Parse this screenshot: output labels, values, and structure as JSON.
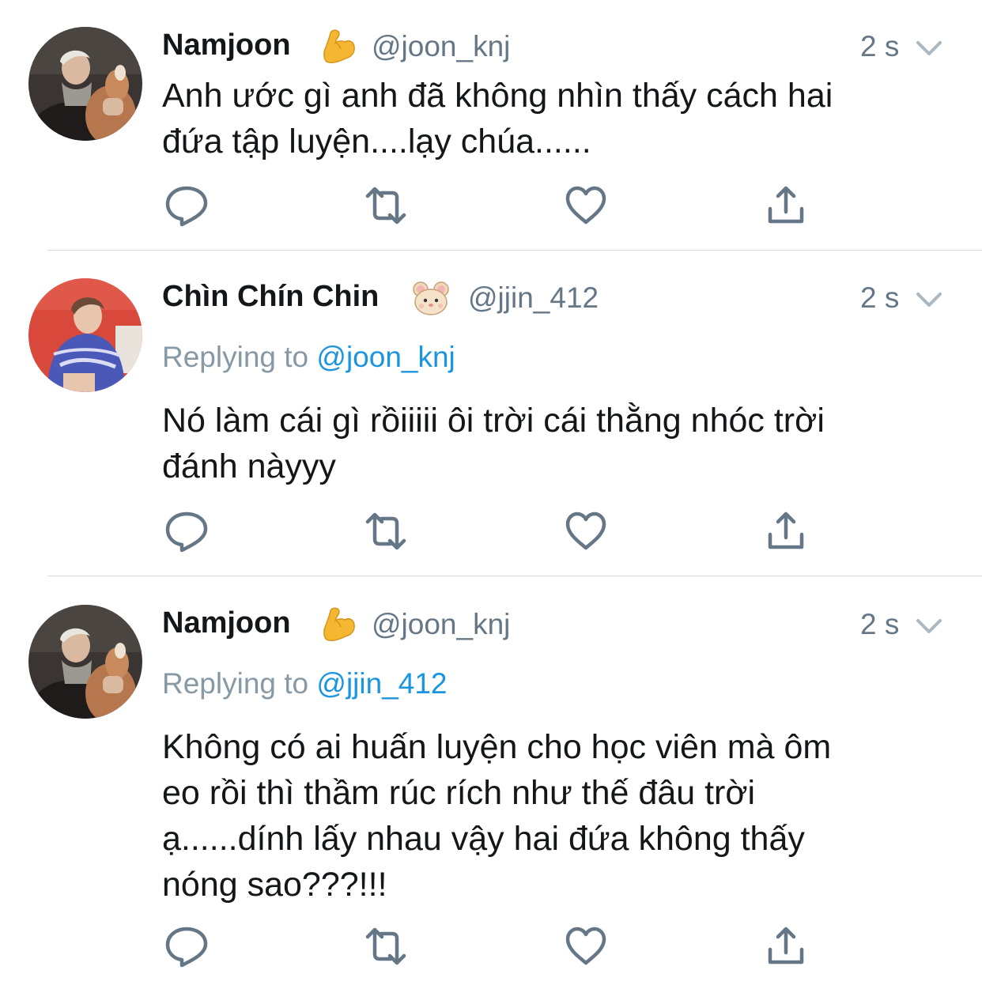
{
  "tweets": [
    {
      "name": "Namjoon",
      "emoji": "flexed-biceps",
      "handle": "@joon_knj",
      "time": "2 s",
      "replying_label": "",
      "replying_to": "",
      "lines": [
        "Anh ước gì anh đã không nhìn thấy cách hai",
        "đứa tập luyện....lạy chúa......"
      ]
    },
    {
      "name": "Chìn Chín Chin",
      "emoji": "hamster",
      "handle": "@jjin_412",
      "time": "2 s",
      "replying_label": "Replying to",
      "replying_to": "@joon_knj",
      "lines": [
        "Nó làm cái gì rồiiiii ôi trời cái thằng nhóc trời",
        "đánh nàyyy"
      ]
    },
    {
      "name": "Namjoon",
      "emoji": "flexed-biceps",
      "handle": "@joon_knj",
      "time": "2 s",
      "replying_label": "Replying to",
      "replying_to": "@jjin_412",
      "lines": [
        "Không có ai huấn luyện cho học viên mà ôm",
        "eo rồi thì thầm rúc rích như thế đâu trời",
        "ạ......dính lấy nhau vậy hai đứa không thấy",
        "nóng sao???!!!"
      ]
    }
  ],
  "icons": {
    "reply": "reply-icon",
    "retweet": "retweet-icon",
    "like": "heart-icon",
    "share": "share-icon",
    "more": "chevron-down-icon"
  },
  "colors": {
    "text": "#14171a",
    "secondary": "#657786",
    "mention": "#1b95e0",
    "icon": "#657786",
    "divider": "#d6dde3"
  }
}
